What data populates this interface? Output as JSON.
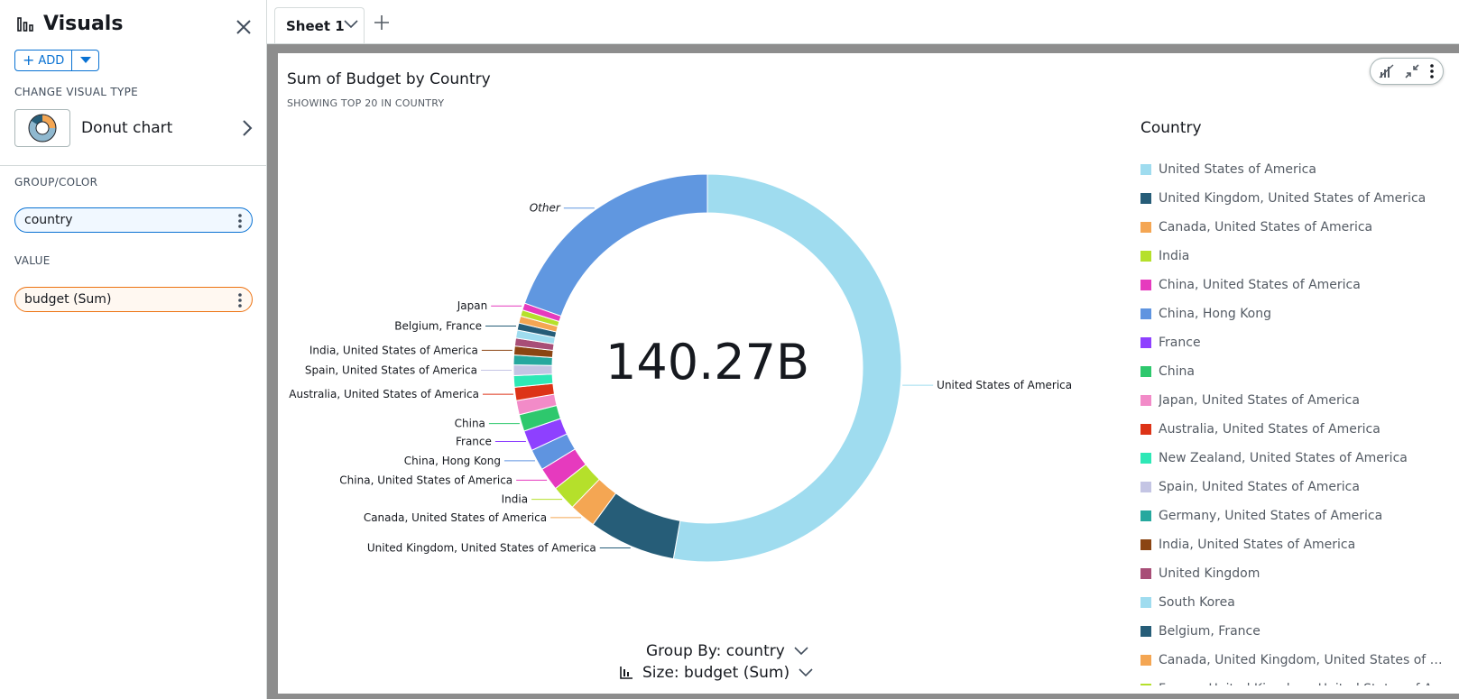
{
  "sidebar": {
    "title": "Visuals",
    "add_label": "ADD",
    "change_visual_type_label": "CHANGE VISUAL TYPE",
    "visual_type": "Donut chart",
    "group_color_label": "GROUP/COLOR",
    "group_field": "country",
    "value_label": "VALUE",
    "value_field": "budget (Sum)"
  },
  "tabs": [
    {
      "label": "Sheet 1"
    }
  ],
  "visual": {
    "title": "Sum of Budget by Country",
    "subtitle": "SHOWING TOP 20 IN COUNTRY",
    "center_value": "140.27B",
    "legend_title": "Country",
    "group_by_label": "Group By: country",
    "size_label": "Size: budget (Sum)"
  },
  "chart_data": {
    "type": "pie",
    "title": "Sum of Budget by Country",
    "subtitle": "SHOWING TOP 20 IN COUNTRY",
    "center_label": "140.27B",
    "legend_title": "Country",
    "legend_placement": "right",
    "total": 140.27,
    "slices": [
      {
        "label": "United States of America",
        "value": 71.5,
        "color": "#9fdcef",
        "legend": true,
        "callout": true
      },
      {
        "label": "United Kingdom, United States of America",
        "value": 9.8,
        "color": "#265d78",
        "legend": true,
        "callout": true
      },
      {
        "label": "Canada, United States of America",
        "value": 3.0,
        "color": "#f4a653",
        "legend": true,
        "callout": true
      },
      {
        "label": "India",
        "value": 2.8,
        "color": "#b5e02b",
        "legend": true,
        "callout": true
      },
      {
        "label": "China, United States of America",
        "value": 2.6,
        "color": "#e63abe",
        "legend": true,
        "callout": true
      },
      {
        "label": "China, Hong Kong",
        "value": 2.4,
        "color": "#5f94e0",
        "legend": true,
        "callout": true
      },
      {
        "label": "France",
        "value": 2.3,
        "color": "#8e40ff",
        "legend": true,
        "callout": true
      },
      {
        "label": "China",
        "value": 1.9,
        "color": "#2ec86d",
        "legend": true,
        "callout": true
      },
      {
        "label": "Japan, United States of America",
        "value": 1.6,
        "color": "#f28bc8",
        "legend": true,
        "callout": false
      },
      {
        "label": "Australia, United States of America",
        "value": 1.5,
        "color": "#dd3317",
        "legend": true,
        "callout": true
      },
      {
        "label": "New Zealand, United States of America",
        "value": 1.3,
        "color": "#2ee8b6",
        "legend": true,
        "callout": false
      },
      {
        "label": "Spain, United States of America",
        "value": 1.2,
        "color": "#c4c5e4",
        "legend": true,
        "callout": true
      },
      {
        "label": "Germany, United States of America",
        "value": 1.1,
        "color": "#26a89e",
        "legend": true,
        "callout": false
      },
      {
        "label": "India, United States of America",
        "value": 1.0,
        "color": "#8b4513",
        "legend": true,
        "callout": true
      },
      {
        "label": "United Kingdom",
        "value": 0.9,
        "color": "#a84e77",
        "legend": true,
        "callout": false
      },
      {
        "label": "South Korea",
        "value": 0.9,
        "color": "#9fdcef",
        "legend": true,
        "callout": false
      },
      {
        "label": "Belgium, France",
        "value": 0.8,
        "color": "#265d78",
        "legend": true,
        "callout": true
      },
      {
        "label": "Canada, United Kingdom, United States of A…",
        "value": 0.8,
        "color": "#f4a653",
        "legend": true,
        "callout": false
      },
      {
        "label": "France, United Kingdom, United States of A…",
        "value": 0.7,
        "color": "#b5e02b",
        "legend": true,
        "callout": false
      },
      {
        "label": "Japan",
        "value": 0.8,
        "color": "#e63abe",
        "legend": false,
        "callout": true
      },
      {
        "label": "Other",
        "value": 26.5,
        "color": "#6097e0",
        "legend": false,
        "callout": true
      }
    ]
  },
  "icons": {
    "visuals": "bar-chart-icon",
    "close": "close-icon",
    "tab_dropdown": "chevron-down-icon",
    "add_sheet": "plus-icon"
  }
}
